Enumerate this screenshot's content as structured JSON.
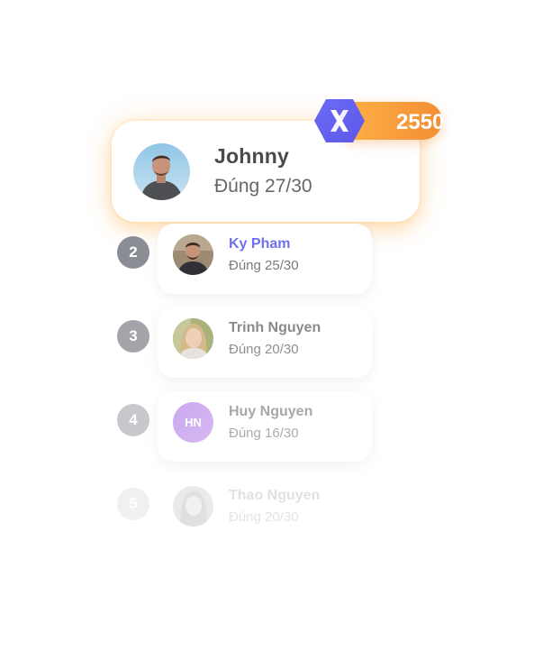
{
  "hero": {
    "name": "Johnny",
    "score": "Đúng 27/30",
    "points": "2550",
    "badge_icon": "x-logo-icon",
    "accent": "#f39a3a"
  },
  "rows": [
    {
      "rank": "2",
      "name": "Ky Pham",
      "score": "Đúng 25/30",
      "name_color": "#6f6ff0",
      "rank_color": "#8b8d95",
      "avatar": "photo-man-beard",
      "opacity": 1
    },
    {
      "rank": "3",
      "name": "Trinh Nguyen",
      "score": "Đúng 20/30",
      "name_color": "#8a8a8a",
      "rank_color": "#a3a5ab",
      "avatar": "photo-woman",
      "opacity": 1
    },
    {
      "rank": "4",
      "name": "Huy Nguyen",
      "score": "Đúng 16/30",
      "initials": "HN",
      "name_color": "#a8a8a8",
      "rank_color": "#c7c8cc",
      "avatar": "initials",
      "opacity": 1
    },
    {
      "rank": "5",
      "name": "Thao Nguyen",
      "score": "Đúng 20/30",
      "name_color": "#c9c9c9",
      "rank_color": "#e3e4e6",
      "avatar": "photo-woman-faded",
      "opacity": 0.55
    }
  ]
}
